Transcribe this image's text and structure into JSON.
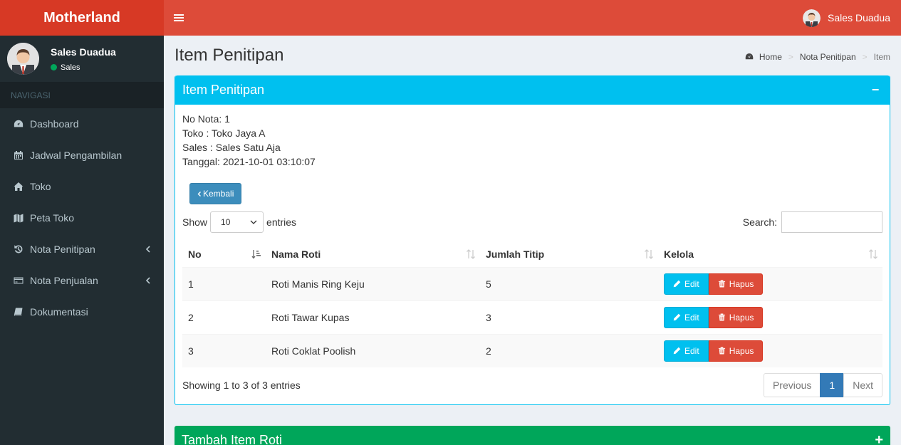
{
  "app": {
    "brand": "Motherland"
  },
  "header": {
    "user_name": "Sales Duadua"
  },
  "sidebar": {
    "user": {
      "name": "Sales Duadua",
      "status": "Sales"
    },
    "nav_header": "NAVIGASI",
    "items": [
      {
        "label": "Dashboard",
        "icon": "dashboard-icon"
      },
      {
        "label": "Jadwal Pengambilan",
        "icon": "calendar-icon"
      },
      {
        "label": "Toko",
        "icon": "home-icon"
      },
      {
        "label": "Peta Toko",
        "icon": "map-icon"
      },
      {
        "label": "Nota Penitipan",
        "icon": "history-icon"
      },
      {
        "label": "Nota Penjualan",
        "icon": "credit-card-icon"
      },
      {
        "label": "Dokumentasi",
        "icon": "book-icon"
      }
    ]
  },
  "page": {
    "title": "Item Penitipan",
    "breadcrumb": {
      "home": "Home",
      "parent": "Nota Penitipan",
      "current": "Item"
    }
  },
  "box": {
    "title": "Item Penitipan",
    "collapse": "−",
    "info": {
      "nota": "No Nota: 1",
      "toko": "Toko : Toko Jaya A",
      "sales": "Sales : Sales Satu Aja",
      "tanggal": "Tanggal: 2021-10-01 03:10:07"
    },
    "back_label": "Kembali"
  },
  "datatable": {
    "show_label": "Show",
    "entries_label": "entries",
    "length_value": "10",
    "search_label": "Search:",
    "search_value": "",
    "columns": [
      "No",
      "Nama Roti",
      "Jumlah Titip",
      "Kelola"
    ],
    "rows": [
      {
        "no": "1",
        "nama": "Roti Manis Ring Keju",
        "jumlah": "5"
      },
      {
        "no": "2",
        "nama": "Roti Tawar Kupas",
        "jumlah": "3"
      },
      {
        "no": "3",
        "nama": "Roti Coklat Poolish",
        "jumlah": "2"
      }
    ],
    "edit_label": "Edit",
    "delete_label": "Hapus",
    "info": "Showing 1 to 3 of 3 entries",
    "pagination": {
      "previous": "Previous",
      "current": "1",
      "next": "Next"
    }
  },
  "box2": {
    "title": "Tambah Item Roti",
    "expand": "+"
  },
  "colors": {
    "header": "#dd4b39",
    "logo": "#d73925",
    "sidebar": "#222d32",
    "box_info": "#00c0ef",
    "box_success": "#00a65a",
    "primary": "#3c8dbc"
  }
}
